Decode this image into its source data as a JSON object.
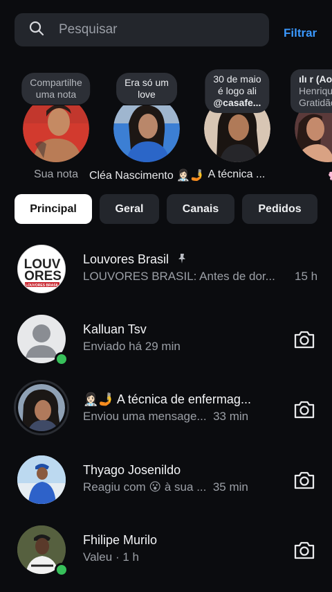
{
  "search": {
    "placeholder": "Pesquisar",
    "filter_label": "Filtrar"
  },
  "notes": [
    {
      "bubble_line1": "Compartilhe",
      "bubble_line2": "uma nota",
      "name": "Sua nota"
    },
    {
      "bubble_line1": "Era só um",
      "bubble_line2": "love",
      "name": "Cléa Nascimento 👩🏻‍⚕️🤳"
    },
    {
      "bubble_line1": "30 de maio",
      "bubble_line2": "é logo ali",
      "bubble_line3": "@casafe...",
      "name": "A técnica ..."
    },
    {
      "bubble_line1": "ılı r (Ao",
      "bubble_line2": "Henrique",
      "bubble_line3": "Gratidão",
      "name": "🌸"
    }
  ],
  "tabs": [
    "Principal",
    "Geral",
    "Canais",
    "Pedidos"
  ],
  "conversations": [
    {
      "name": "Louvores Brasil",
      "preview": "LOUVORES BRASIL: Antes de dor...",
      "time": "15 h",
      "logo_top": "LOUV",
      "logo_mid": "ORES",
      "logo_bottom": "LOUVORES BRASIL"
    },
    {
      "name": "Kalluan Tsv",
      "preview": "Enviado há 29 min"
    },
    {
      "name": "👩🏻‍⚕️🤳  A técnica de enfermag...",
      "preview": "Enviou uma mensage...",
      "time": "33 min"
    },
    {
      "name": "Thyago Josenildo",
      "preview": "Reagiu com 😮 à sua ...",
      "time": "35 min"
    },
    {
      "name": "Fhilipe Murilo",
      "preview": "Valeu · 1 h"
    }
  ],
  "colors": {
    "background": "#0b0c0f",
    "accent": "#3b99ff",
    "online": "#37c05a",
    "tab_active_bg": "#ffffff"
  },
  "icons": [
    "search-icon",
    "pin-icon",
    "camera-icon"
  ]
}
